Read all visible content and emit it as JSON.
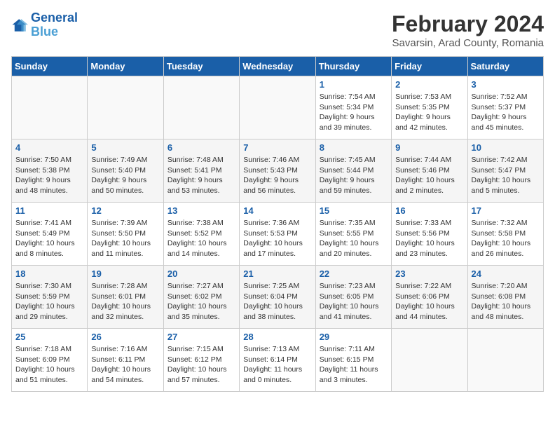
{
  "logo": {
    "line1": "General",
    "line2": "Blue"
  },
  "title": "February 2024",
  "subtitle": "Savarsin, Arad County, Romania",
  "weekdays": [
    "Sunday",
    "Monday",
    "Tuesday",
    "Wednesday",
    "Thursday",
    "Friday",
    "Saturday"
  ],
  "weeks": [
    [
      {
        "day": "",
        "info": ""
      },
      {
        "day": "",
        "info": ""
      },
      {
        "day": "",
        "info": ""
      },
      {
        "day": "",
        "info": ""
      },
      {
        "day": "1",
        "info": "Sunrise: 7:54 AM\nSunset: 5:34 PM\nDaylight: 9 hours\nand 39 minutes."
      },
      {
        "day": "2",
        "info": "Sunrise: 7:53 AM\nSunset: 5:35 PM\nDaylight: 9 hours\nand 42 minutes."
      },
      {
        "day": "3",
        "info": "Sunrise: 7:52 AM\nSunset: 5:37 PM\nDaylight: 9 hours\nand 45 minutes."
      }
    ],
    [
      {
        "day": "4",
        "info": "Sunrise: 7:50 AM\nSunset: 5:38 PM\nDaylight: 9 hours\nand 48 minutes."
      },
      {
        "day": "5",
        "info": "Sunrise: 7:49 AM\nSunset: 5:40 PM\nDaylight: 9 hours\nand 50 minutes."
      },
      {
        "day": "6",
        "info": "Sunrise: 7:48 AM\nSunset: 5:41 PM\nDaylight: 9 hours\nand 53 minutes."
      },
      {
        "day": "7",
        "info": "Sunrise: 7:46 AM\nSunset: 5:43 PM\nDaylight: 9 hours\nand 56 minutes."
      },
      {
        "day": "8",
        "info": "Sunrise: 7:45 AM\nSunset: 5:44 PM\nDaylight: 9 hours\nand 59 minutes."
      },
      {
        "day": "9",
        "info": "Sunrise: 7:44 AM\nSunset: 5:46 PM\nDaylight: 10 hours\nand 2 minutes."
      },
      {
        "day": "10",
        "info": "Sunrise: 7:42 AM\nSunset: 5:47 PM\nDaylight: 10 hours\nand 5 minutes."
      }
    ],
    [
      {
        "day": "11",
        "info": "Sunrise: 7:41 AM\nSunset: 5:49 PM\nDaylight: 10 hours\nand 8 minutes."
      },
      {
        "day": "12",
        "info": "Sunrise: 7:39 AM\nSunset: 5:50 PM\nDaylight: 10 hours\nand 11 minutes."
      },
      {
        "day": "13",
        "info": "Sunrise: 7:38 AM\nSunset: 5:52 PM\nDaylight: 10 hours\nand 14 minutes."
      },
      {
        "day": "14",
        "info": "Sunrise: 7:36 AM\nSunset: 5:53 PM\nDaylight: 10 hours\nand 17 minutes."
      },
      {
        "day": "15",
        "info": "Sunrise: 7:35 AM\nSunset: 5:55 PM\nDaylight: 10 hours\nand 20 minutes."
      },
      {
        "day": "16",
        "info": "Sunrise: 7:33 AM\nSunset: 5:56 PM\nDaylight: 10 hours\nand 23 minutes."
      },
      {
        "day": "17",
        "info": "Sunrise: 7:32 AM\nSunset: 5:58 PM\nDaylight: 10 hours\nand 26 minutes."
      }
    ],
    [
      {
        "day": "18",
        "info": "Sunrise: 7:30 AM\nSunset: 5:59 PM\nDaylight: 10 hours\nand 29 minutes."
      },
      {
        "day": "19",
        "info": "Sunrise: 7:28 AM\nSunset: 6:01 PM\nDaylight: 10 hours\nand 32 minutes."
      },
      {
        "day": "20",
        "info": "Sunrise: 7:27 AM\nSunset: 6:02 PM\nDaylight: 10 hours\nand 35 minutes."
      },
      {
        "day": "21",
        "info": "Sunrise: 7:25 AM\nSunset: 6:04 PM\nDaylight: 10 hours\nand 38 minutes."
      },
      {
        "day": "22",
        "info": "Sunrise: 7:23 AM\nSunset: 6:05 PM\nDaylight: 10 hours\nand 41 minutes."
      },
      {
        "day": "23",
        "info": "Sunrise: 7:22 AM\nSunset: 6:06 PM\nDaylight: 10 hours\nand 44 minutes."
      },
      {
        "day": "24",
        "info": "Sunrise: 7:20 AM\nSunset: 6:08 PM\nDaylight: 10 hours\nand 48 minutes."
      }
    ],
    [
      {
        "day": "25",
        "info": "Sunrise: 7:18 AM\nSunset: 6:09 PM\nDaylight: 10 hours\nand 51 minutes."
      },
      {
        "day": "26",
        "info": "Sunrise: 7:16 AM\nSunset: 6:11 PM\nDaylight: 10 hours\nand 54 minutes."
      },
      {
        "day": "27",
        "info": "Sunrise: 7:15 AM\nSunset: 6:12 PM\nDaylight: 10 hours\nand 57 minutes."
      },
      {
        "day": "28",
        "info": "Sunrise: 7:13 AM\nSunset: 6:14 PM\nDaylight: 11 hours\nand 0 minutes."
      },
      {
        "day": "29",
        "info": "Sunrise: 7:11 AM\nSunset: 6:15 PM\nDaylight: 11 hours\nand 3 minutes."
      },
      {
        "day": "",
        "info": ""
      },
      {
        "day": "",
        "info": ""
      }
    ]
  ]
}
